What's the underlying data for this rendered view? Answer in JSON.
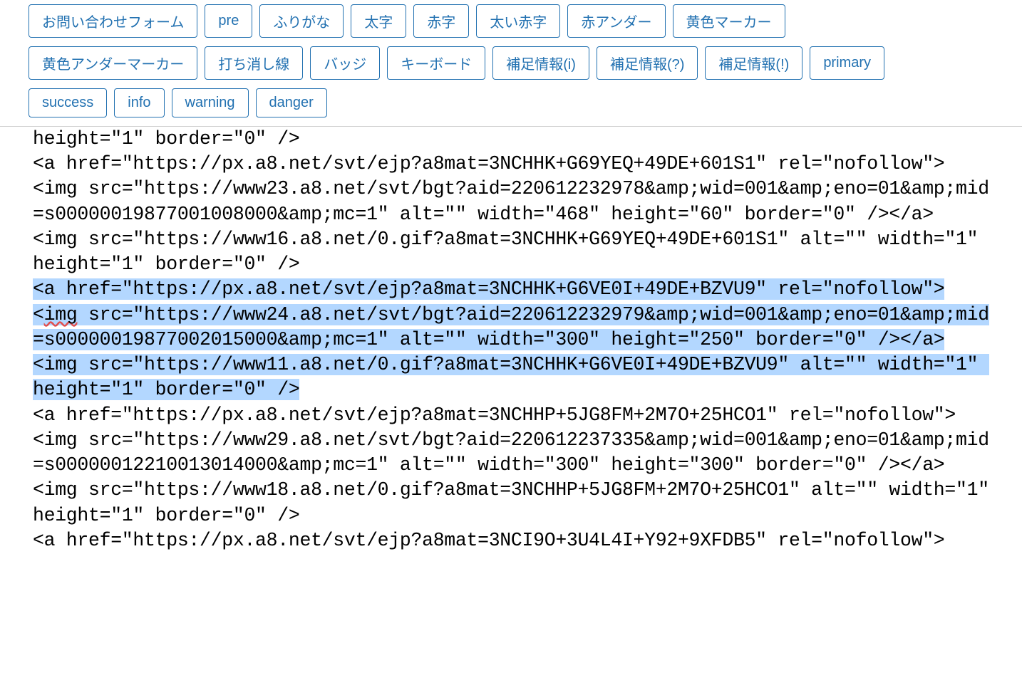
{
  "toolbar": {
    "rows": [
      [
        "お問い合わせフォーム",
        "pre",
        "ふりがな",
        "太字",
        "赤字",
        "太い赤字",
        "赤アンダー",
        "黄色マーカー"
      ],
      [
        "黄色アンダーマーカー",
        "打ち消し線",
        "バッジ",
        "キーボード",
        "補足情報(i)",
        "補足情報(?)",
        "補足情報(!)",
        "primary"
      ],
      [
        "success",
        "info",
        "warning",
        "danger"
      ]
    ]
  },
  "code": {
    "lines": [
      {
        "text": "height=\"1\" border=\"0\" />",
        "sel": false
      },
      {
        "text": "<a href=\"https://px.a8.net/svt/ejp?a8mat=3NCHHK+G69YEQ+49DE+601S1\" rel=\"nofollow\">",
        "sel": false
      },
      {
        "text": "<img src=\"https://www23.a8.net/svt/bgt?aid=220612232978&amp;wid=001&amp;eno=01&amp;mid=s00000019877001008000&amp;mc=1\" alt=\"\" width=\"468\" height=\"60\" border=\"0\" /></a>",
        "sel": false
      },
      {
        "text": "<img src=\"https://www16.a8.net/0.gif?a8mat=3NCHHK+G69YEQ+49DE+601S1\" alt=\"\" width=\"1\" height=\"1\" border=\"0\" />",
        "sel": false
      },
      {
        "text": "<a href=\"https://px.a8.net/svt/ejp?a8mat=3NCHHK+G6VE0I+49DE+BZVU9\" rel=\"nofollow\">",
        "sel": true
      },
      {
        "text": "<img src=\"https://www24.a8.net/svt/bgt?aid=220612232979&amp;wid=001&amp;eno=01&amp;mid=s00000019877002015000&amp;mc=1\" alt=\"\" width=\"300\" height=\"250\" border=\"0\" /></a>",
        "sel": true,
        "squiggle": "img"
      },
      {
        "text": "<img src=\"https://www11.a8.net/0.gif?a8mat=3NCHHK+G6VE0I+49DE+BZVU9\" alt=\"\" width=\"1\" height=\"1\" border=\"0\" />",
        "sel": true
      },
      {
        "text": "<a href=\"https://px.a8.net/svt/ejp?a8mat=3NCHHP+5JG8FM+2M7O+25HCO1\" rel=\"nofollow\">",
        "sel": false
      },
      {
        "text": "<img src=\"https://www29.a8.net/svt/bgt?aid=220612237335&amp;wid=001&amp;eno=01&amp;mid=s00000012210013014000&amp;mc=1\" alt=\"\" width=\"300\" height=\"300\" border=\"0\" /></a>",
        "sel": false
      },
      {
        "text": "<img src=\"https://www18.a8.net/0.gif?a8mat=3NCHHP+5JG8FM+2M7O+25HCO1\" alt=\"\" width=\"1\" height=\"1\" border=\"0\" />",
        "sel": false
      },
      {
        "text": "<a href=\"https://px.a8.net/svt/ejp?a8mat=3NCI9O+3U4L4I+Y92+9XFDB5\" rel=\"nofollow\">",
        "sel": false
      }
    ]
  }
}
